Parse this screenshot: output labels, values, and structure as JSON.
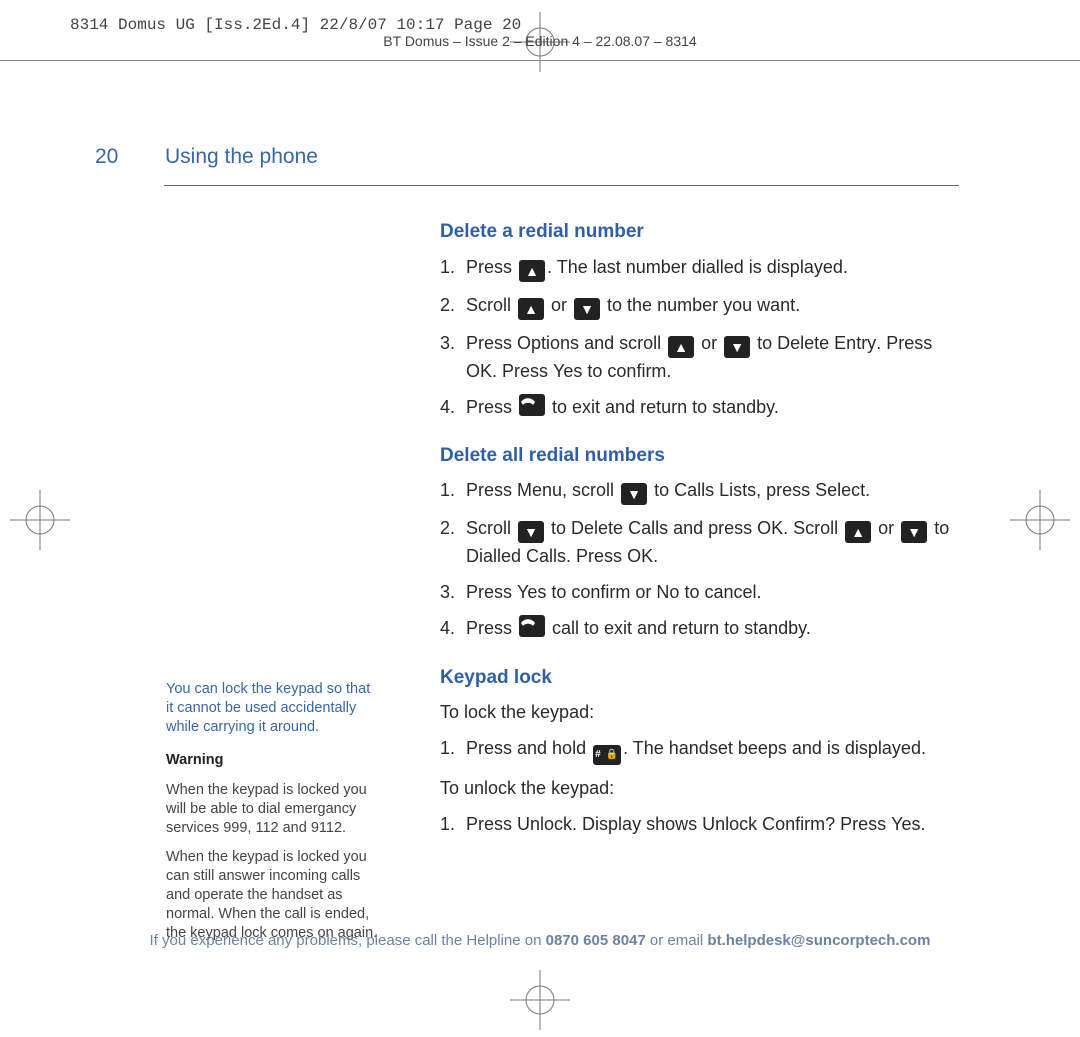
{
  "slug": "8314 Domus UG [Iss.2Ed.4]  22/8/07  10:17  Page 20",
  "running_head": "BT Domus – Issue 2 – Edition 4 – 22.08.07 – 8314",
  "page_number": "20",
  "page_title": "Using the phone",
  "sections": {
    "delete_redial": {
      "heading": "Delete a redial number",
      "s1a": "Press ",
      "s1b": ". The last number dialled is displayed.",
      "s2a": "Scroll ",
      "s2b": " or ",
      "s2c": " to the number you want.",
      "s3a": "Press ",
      "s3a_ui": "Options",
      "s3b": " and scroll ",
      "s3c": " or ",
      "s3d": " to ",
      "s3d_ui": "Delete Entry",
      "s3e": ". Press ",
      "s3e_ui": "OK.",
      "s3f": " Press ",
      "s3f_ui": "Yes",
      "s3g": " to confirm.",
      "s4a": "Press ",
      "s4b": " to exit and return to standby."
    },
    "delete_all": {
      "heading": "Delete all redial numbers",
      "s1a": "Press ",
      "s1a_ui": "Menu",
      "s1b": ", scroll ",
      "s1c": " to ",
      "s1c_ui": "Calls Lists",
      "s1d": ", press ",
      "s1d_ui": "Select",
      "s1e": ".",
      "s2a": "Scroll ",
      "s2b": " to ",
      "s2b_ui": "Delete Calls",
      "s2c": " and press ",
      "s2c_ui": "OK.",
      "s2d": " Scroll ",
      "s2e": " or ",
      "s2f": " to ",
      "s2f_ui": "Dialled Calls",
      "s2g": ". Press ",
      "s2g_ui": "OK.",
      "s3a": "Press ",
      "s3a_ui": "Yes",
      "s3b": " to confirm or ",
      "s3b_ui": "No",
      "s3c": " to cancel.",
      "s4a": "Press ",
      "s4b": " call to exit and return to standby."
    },
    "keypad_lock": {
      "heading": "Keypad lock",
      "intro_lock": "To lock the keypad:",
      "l1a": "Press and hold ",
      "l1b": ". The handset beeps and      is displayed.",
      "intro_unlock": "To unlock the keypad:",
      "u1a": "Press ",
      "u1a_ui": "Unlock",
      "u1b": ". Display shows ",
      "u1b_ui": "Unlock Confirm?",
      "u1c": " Press ",
      "u1c_ui": "Yes",
      "u1d": "."
    }
  },
  "numbers": {
    "n1": "1.",
    "n2": "2.",
    "n3": "3.",
    "n4": "4."
  },
  "sidebar": {
    "tip": "You can lock the keypad so that it cannot be used accidentally while carrying it around.",
    "warn_head": "Warning",
    "warn1": "When the keypad is locked you will be able to dial emergancy services 999, 112 and 9112.",
    "warn2": "When the keypad is locked you can still answer incoming calls and operate the handset as normal. When the call is ended, the keypad lock comes on again."
  },
  "footer": {
    "t1": "If you experience any problems, please call the Helpline on ",
    "phone": "0870 605 8047",
    "t2": " or email ",
    "email": "bt.helpdesk@suncorptech.com"
  }
}
